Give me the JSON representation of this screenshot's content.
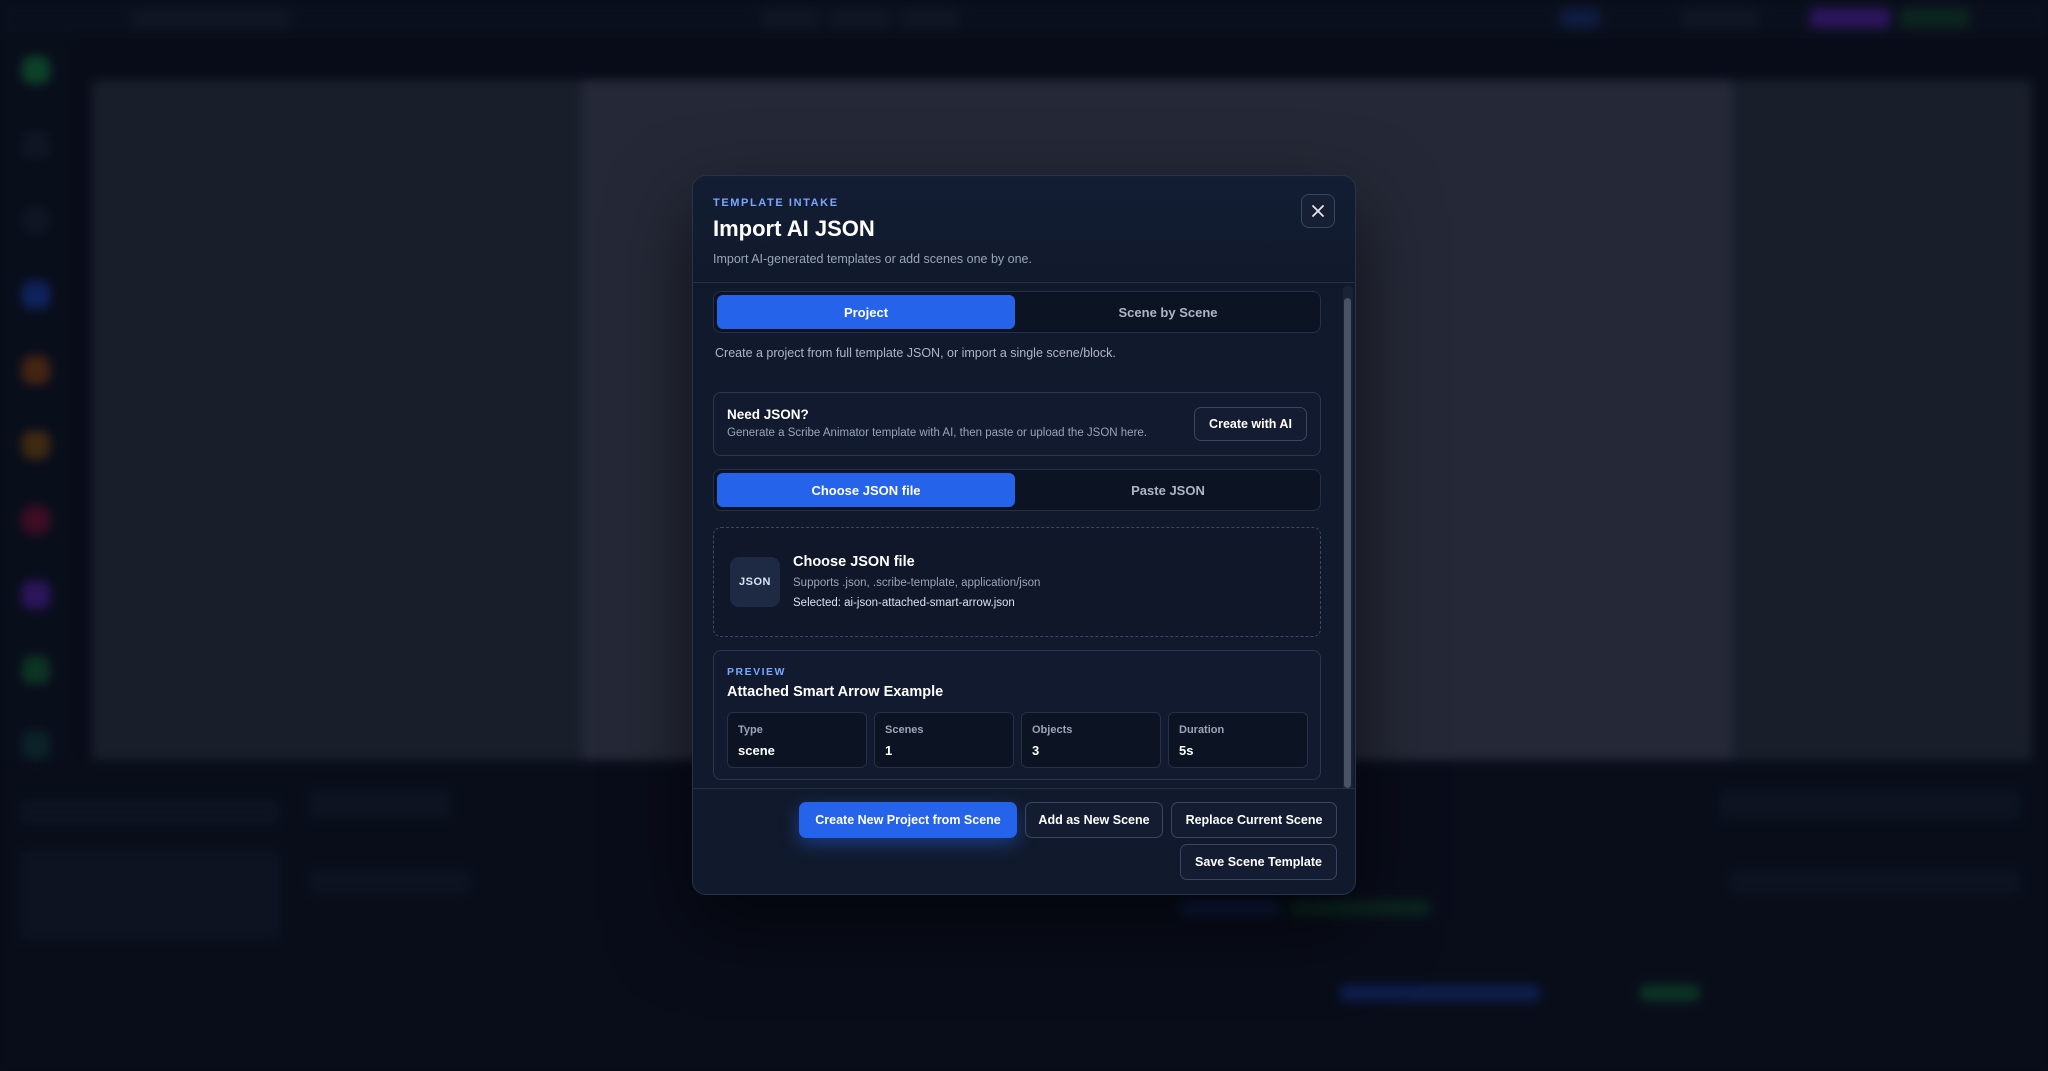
{
  "modal": {
    "eyebrow": "TEMPLATE INTAKE",
    "title": "Import AI JSON",
    "subtitle": "Import AI-generated templates or add scenes one by one.",
    "close_icon": "close-icon"
  },
  "mode_tabs": [
    {
      "label": "Project",
      "active": true
    },
    {
      "label": "Scene by Scene",
      "active": false
    }
  ],
  "description": "Create a project from full template JSON, or import a single scene/block.",
  "need_json": {
    "title": "Need JSON?",
    "subtitle": "Generate a Scribe Animator template with AI, then paste or upload the JSON here.",
    "button_label": "Create with AI"
  },
  "source_tabs": [
    {
      "label": "Choose JSON file",
      "active": true
    },
    {
      "label": "Paste JSON",
      "active": false
    }
  ],
  "file_picker": {
    "badge": "JSON",
    "title": "Choose JSON file",
    "supports": "Supports .json, .scribe-template, application/json",
    "selected": "Selected: ai-json-attached-smart-arrow.json"
  },
  "preview": {
    "eyebrow": "PREVIEW",
    "title": "Attached Smart Arrow Example",
    "stats": [
      {
        "label": "Type",
        "value": "scene"
      },
      {
        "label": "Scenes",
        "value": "1"
      },
      {
        "label": "Objects",
        "value": "3"
      },
      {
        "label": "Duration",
        "value": "5s"
      }
    ]
  },
  "footer": {
    "create_project": "Create New Project from Scene",
    "add_scene": "Add as New Scene",
    "replace_scene": "Replace Current Scene",
    "save_template": "Save Scene Template"
  },
  "colors": {
    "accent": "#2563eb",
    "eyebrow": "#7aa7ff",
    "modal_bg": "#111a2c"
  }
}
